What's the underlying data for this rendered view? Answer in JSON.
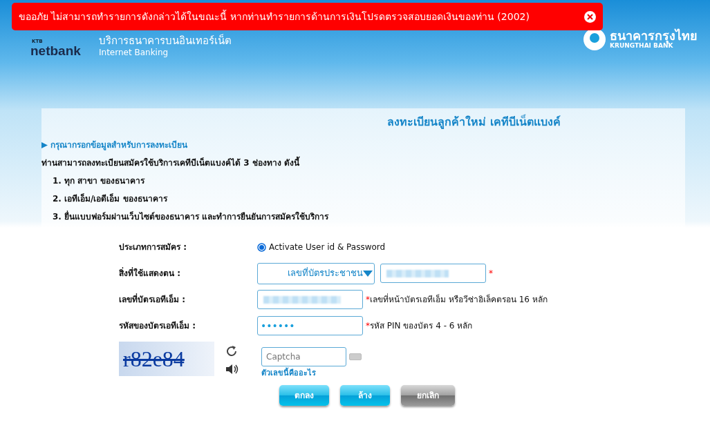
{
  "alert": {
    "message": "ขออภัย ไม่สามารถทำรายการดังกล่าวได้ในขณะนี้ หากท่านทำรายการด้านการเงินโปรดตรวจสอบยอดเงินของท่าน (2002)"
  },
  "header": {
    "logo_small": "KTB",
    "logo_name": "netbank",
    "service_th": "บริการธนาคารบนอินเทอร์เน็ต",
    "service_en": "Internet Banking",
    "bank_th": "ธนาคารกรุงไทย",
    "bank_en": "KRUNGTHAI BANK"
  },
  "title": "ลงทะเบียนลูกค้าใหม่ เคทีบีเน็ตแบงค์",
  "section_heading": "กรุณากรอกข้อมูลสำหรับการลงทะเบียน",
  "intro": "ท่านสามารถลงทะเบียนสมัครใช้บริการเคทีบีเน็ตแบงค์ได้ 3 ช่องทาง ดังนี้",
  "channels": [
    "1. ทุก สาขา ของธนาคาร",
    "2. เอทีเอ็ม/เอดีเอ็ม ของธนาคาร",
    "3. ยื่นแบบฟอร์มผ่านเว็บไซต์ของธนาคาร และทำการยืนยันการสมัครใช้บริการ"
  ],
  "form": {
    "type_label": "ประเภทการสมัคร :",
    "type_option": {
      "label": "Activate User id & Password",
      "selected": true
    },
    "id_label": "สิ่งที่ใช้แสดงตน :",
    "id_select": "เลขที่บัตรประชาชน",
    "id_hint": "*",
    "card_label": "เลขที่บัตรเอทีเอ็ม :",
    "card_hint": "เลขที่หน้าบัตรเอทีเอ็ม หรือวีซ่าอิเล็คตรอน 16 หลัก",
    "pin_label": "รหัสของบัตรเอทีเอ็ม :",
    "pin_value": "••••••",
    "pin_hint": "รหัส PIN ของบัตร 4 - 6 หลัก",
    "captcha_text": "r82e84",
    "captcha_placeholder": "Captcha",
    "captcha_help": "ตัวเลขนี้คืออะไร"
  },
  "buttons": [
    {
      "label": "ตกลง",
      "kind": "primary"
    },
    {
      "label": "ล้าง",
      "kind": "primary"
    },
    {
      "label": "ยกเลิก",
      "kind": "secondary"
    }
  ]
}
